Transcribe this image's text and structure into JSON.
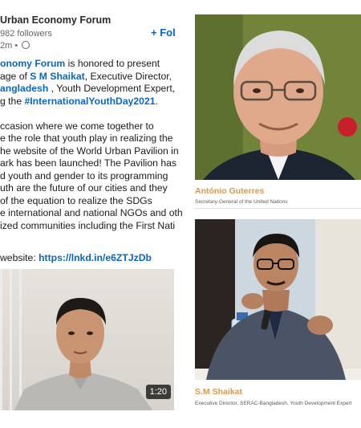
{
  "post": {
    "author": "Urban Economy Forum",
    "followers": "982 followers",
    "time": "2m •",
    "follow_label": "+ Fol",
    "lines": {
      "l1_link": "onomy Forum",
      "l1_rest": " is honored to present",
      "l2_pre": "age of ",
      "l2_link": "S M Shaikat",
      "l2_rest": ", Executive Director,",
      "l3_link": "angladesh",
      "l3_rest": " , Youth Development Expert,",
      "l4_pre": "g the ",
      "l4_link": "#InternationalYouthDay2021",
      "l4_rest": ".",
      "l6": "ccasion where we come together to",
      "l7": "e the role that youth play in realizing the",
      "l8": "he website of the World Urban Pavilion in",
      "l9": "ark has been launched! The Pavilion has",
      "l10": "d youth and gender to its programming",
      "l11": "uth are the future of our cities and they",
      "l12": "of the equation to realize the SDGs",
      "l13": "e international and national NGOs and oth",
      "l14": "ized communities including the First Nati"
    },
    "website_label": " website: ",
    "website_link": "https://lnkd.in/e6ZTJzDb",
    "video_duration": "1:20"
  },
  "poster": {
    "person1_name": "António Guterres",
    "person1_title": "Secretary-General of the United Nations",
    "person2_name": "S.M Shaikat",
    "person2_title": "Executive Director, SERAC-Bangladesh, Youth Development Expert"
  },
  "colors": {
    "link": "#0a66c2",
    "name_accent": "#d49a55"
  }
}
